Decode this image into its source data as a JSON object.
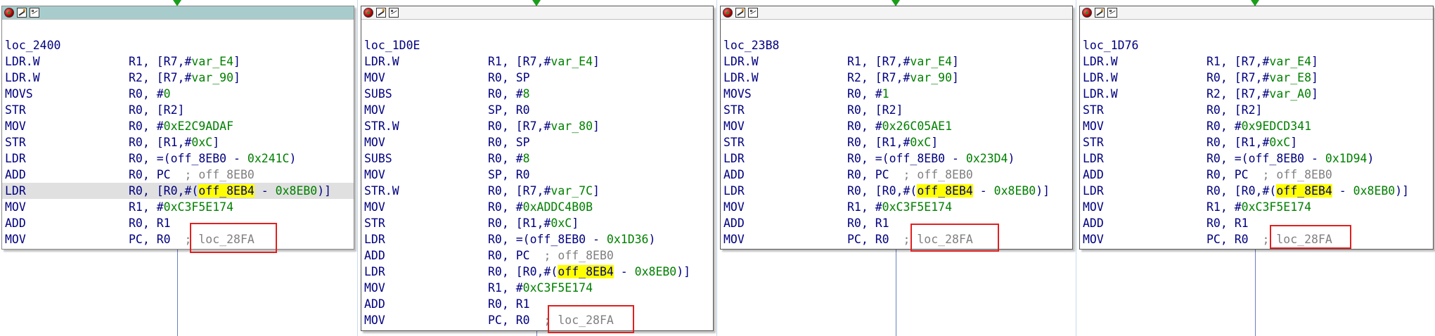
{
  "blocks": [
    {
      "label": "loc_2400",
      "selected": true,
      "lines": [
        {
          "mn": "LDR.W",
          "ops": [
            {
              "t": "op",
              "v": "R1, [R7,#"
            },
            {
              "t": "var",
              "v": "var_E4"
            },
            {
              "t": "op",
              "v": "]"
            }
          ]
        },
        {
          "mn": "LDR.W",
          "ops": [
            {
              "t": "op",
              "v": "R2, [R7,#"
            },
            {
              "t": "var",
              "v": "var_90"
            },
            {
              "t": "op",
              "v": "]"
            }
          ]
        },
        {
          "mn": "MOVS",
          "ops": [
            {
              "t": "op",
              "v": "R0, #"
            },
            {
              "t": "num",
              "v": "0"
            }
          ]
        },
        {
          "mn": "STR",
          "ops": [
            {
              "t": "op",
              "v": "R0, [R2]"
            }
          ]
        },
        {
          "mn": "MOV",
          "ops": [
            {
              "t": "op",
              "v": "R0, #"
            },
            {
              "t": "num",
              "v": "0xE2C9ADAF"
            }
          ]
        },
        {
          "mn": "STR",
          "ops": [
            {
              "t": "op",
              "v": "R0, [R1,#"
            },
            {
              "t": "num",
              "v": "0xC"
            },
            {
              "t": "op",
              "v": "]"
            }
          ]
        },
        {
          "mn": "LDR",
          "ops": [
            {
              "t": "op",
              "v": "R0, =(off_8EB0 - "
            },
            {
              "t": "num",
              "v": "0x241C"
            },
            {
              "t": "op",
              "v": ")"
            }
          ]
        },
        {
          "mn": "ADD",
          "ops": [
            {
              "t": "op",
              "v": "R0, PC  "
            },
            {
              "t": "cmt",
              "v": "; off_8EB0"
            }
          ]
        },
        {
          "mn": "LDR",
          "hl": true,
          "ops": [
            {
              "t": "op",
              "v": "R0, [R0,#("
            },
            {
              "t": "hlsym",
              "v": "off_8EB4"
            },
            {
              "t": "op",
              "v": " - "
            },
            {
              "t": "num",
              "v": "0x8EB0"
            },
            {
              "t": "op",
              "v": ")]"
            }
          ]
        },
        {
          "mn": "MOV",
          "ops": [
            {
              "t": "op",
              "v": "R1, #"
            },
            {
              "t": "num",
              "v": "0xC3F5E174"
            }
          ]
        },
        {
          "mn": "ADD",
          "ops": [
            {
              "t": "op",
              "v": "R0, R1"
            }
          ]
        },
        {
          "mn": "MOV",
          "ops": [
            {
              "t": "op",
              "v": "PC, R0  "
            },
            {
              "t": "cmt",
              "v": "; loc_28FA"
            }
          ]
        }
      ]
    },
    {
      "label": "loc_1D0E",
      "selected": false,
      "lines": [
        {
          "mn": "LDR.W",
          "ops": [
            {
              "t": "op",
              "v": "R1, [R7,#"
            },
            {
              "t": "var",
              "v": "var_E4"
            },
            {
              "t": "op",
              "v": "]"
            }
          ]
        },
        {
          "mn": "MOV",
          "ops": [
            {
              "t": "op",
              "v": "R0, SP"
            }
          ]
        },
        {
          "mn": "SUBS",
          "ops": [
            {
              "t": "op",
              "v": "R0, #"
            },
            {
              "t": "num",
              "v": "8"
            }
          ]
        },
        {
          "mn": "MOV",
          "ops": [
            {
              "t": "op",
              "v": "SP, R0"
            }
          ]
        },
        {
          "mn": "STR.W",
          "ops": [
            {
              "t": "op",
              "v": "R0, [R7,#"
            },
            {
              "t": "var",
              "v": "var_80"
            },
            {
              "t": "op",
              "v": "]"
            }
          ]
        },
        {
          "mn": "MOV",
          "ops": [
            {
              "t": "op",
              "v": "R0, SP"
            }
          ]
        },
        {
          "mn": "SUBS",
          "ops": [
            {
              "t": "op",
              "v": "R0, #"
            },
            {
              "t": "num",
              "v": "8"
            }
          ]
        },
        {
          "mn": "MOV",
          "ops": [
            {
              "t": "op",
              "v": "SP, R0"
            }
          ]
        },
        {
          "mn": "STR.W",
          "ops": [
            {
              "t": "op",
              "v": "R0, [R7,#"
            },
            {
              "t": "var",
              "v": "var_7C"
            },
            {
              "t": "op",
              "v": "]"
            }
          ]
        },
        {
          "mn": "MOV",
          "ops": [
            {
              "t": "op",
              "v": "R0, #"
            },
            {
              "t": "num",
              "v": "0xADDC4B0B"
            }
          ]
        },
        {
          "mn": "STR",
          "ops": [
            {
              "t": "op",
              "v": "R0, [R1,#"
            },
            {
              "t": "num",
              "v": "0xC"
            },
            {
              "t": "op",
              "v": "]"
            }
          ]
        },
        {
          "mn": "LDR",
          "ops": [
            {
              "t": "op",
              "v": "R0, =(off_8EB0 - "
            },
            {
              "t": "num",
              "v": "0x1D36"
            },
            {
              "t": "op",
              "v": ")"
            }
          ]
        },
        {
          "mn": "ADD",
          "ops": [
            {
              "t": "op",
              "v": "R0, PC  "
            },
            {
              "t": "cmt",
              "v": "; off_8EB0"
            }
          ]
        },
        {
          "mn": "LDR",
          "ops": [
            {
              "t": "op",
              "v": "R0, [R0,#("
            },
            {
              "t": "hlsym",
              "v": "off_8EB4"
            },
            {
              "t": "op",
              "v": " - "
            },
            {
              "t": "num",
              "v": "0x8EB0"
            },
            {
              "t": "op",
              "v": ")]"
            }
          ]
        },
        {
          "mn": "MOV",
          "ops": [
            {
              "t": "op",
              "v": "R1, #"
            },
            {
              "t": "num",
              "v": "0xC3F5E174"
            }
          ]
        },
        {
          "mn": "ADD",
          "ops": [
            {
              "t": "op",
              "v": "R0, R1"
            }
          ]
        },
        {
          "mn": "MOV",
          "ops": [
            {
              "t": "op",
              "v": "PC, R0  "
            },
            {
              "t": "cmt",
              "v": "; loc_28FA"
            }
          ]
        }
      ]
    },
    {
      "label": "loc_23B8",
      "selected": false,
      "lines": [
        {
          "mn": "LDR.W",
          "ops": [
            {
              "t": "op",
              "v": "R1, [R7,#"
            },
            {
              "t": "var",
              "v": "var_E4"
            },
            {
              "t": "op",
              "v": "]"
            }
          ]
        },
        {
          "mn": "LDR.W",
          "ops": [
            {
              "t": "op",
              "v": "R2, [R7,#"
            },
            {
              "t": "var",
              "v": "var_90"
            },
            {
              "t": "op",
              "v": "]"
            }
          ]
        },
        {
          "mn": "MOVS",
          "ops": [
            {
              "t": "op",
              "v": "R0, #"
            },
            {
              "t": "num",
              "v": "1"
            }
          ]
        },
        {
          "mn": "STR",
          "ops": [
            {
              "t": "op",
              "v": "R0, [R2]"
            }
          ]
        },
        {
          "mn": "MOV",
          "ops": [
            {
              "t": "op",
              "v": "R0, #"
            },
            {
              "t": "num",
              "v": "0x26C05AE1"
            }
          ]
        },
        {
          "mn": "STR",
          "ops": [
            {
              "t": "op",
              "v": "R0, [R1,#"
            },
            {
              "t": "num",
              "v": "0xC"
            },
            {
              "t": "op",
              "v": "]"
            }
          ]
        },
        {
          "mn": "LDR",
          "ops": [
            {
              "t": "op",
              "v": "R0, =(off_8EB0 - "
            },
            {
              "t": "num",
              "v": "0x23D4"
            },
            {
              "t": "op",
              "v": ")"
            }
          ]
        },
        {
          "mn": "ADD",
          "ops": [
            {
              "t": "op",
              "v": "R0, PC  "
            },
            {
              "t": "cmt",
              "v": "; off_8EB0"
            }
          ]
        },
        {
          "mn": "LDR",
          "ops": [
            {
              "t": "op",
              "v": "R0, [R0,#("
            },
            {
              "t": "hlsym",
              "v": "off_8EB4"
            },
            {
              "t": "op",
              "v": " - "
            },
            {
              "t": "num",
              "v": "0x8EB0"
            },
            {
              "t": "op",
              "v": ")]"
            }
          ]
        },
        {
          "mn": "MOV",
          "ops": [
            {
              "t": "op",
              "v": "R1, #"
            },
            {
              "t": "num",
              "v": "0xC3F5E174"
            }
          ]
        },
        {
          "mn": "ADD",
          "ops": [
            {
              "t": "op",
              "v": "R0, R1"
            }
          ]
        },
        {
          "mn": "MOV",
          "ops": [
            {
              "t": "op",
              "v": "PC, R0  "
            },
            {
              "t": "cmt",
              "v": "; loc_28FA"
            }
          ]
        }
      ]
    },
    {
      "label": "loc_1D76",
      "selected": false,
      "lines": [
        {
          "mn": "LDR.W",
          "ops": [
            {
              "t": "op",
              "v": "R1, [R7,#"
            },
            {
              "t": "var",
              "v": "var_E4"
            },
            {
              "t": "op",
              "v": "]"
            }
          ]
        },
        {
          "mn": "LDR.W",
          "ops": [
            {
              "t": "op",
              "v": "R0, [R7,#"
            },
            {
              "t": "var",
              "v": "var_E8"
            },
            {
              "t": "op",
              "v": "]"
            }
          ]
        },
        {
          "mn": "LDR.W",
          "ops": [
            {
              "t": "op",
              "v": "R2, [R7,#"
            },
            {
              "t": "var",
              "v": "var_A0"
            },
            {
              "t": "op",
              "v": "]"
            }
          ]
        },
        {
          "mn": "STR",
          "ops": [
            {
              "t": "op",
              "v": "R0, [R2]"
            }
          ]
        },
        {
          "mn": "MOV",
          "ops": [
            {
              "t": "op",
              "v": "R0, #"
            },
            {
              "t": "num",
              "v": "0x9EDCD341"
            }
          ]
        },
        {
          "mn": "STR",
          "ops": [
            {
              "t": "op",
              "v": "R0, [R1,#"
            },
            {
              "t": "num",
              "v": "0xC"
            },
            {
              "t": "op",
              "v": "]"
            }
          ]
        },
        {
          "mn": "LDR",
          "ops": [
            {
              "t": "op",
              "v": "R0, =(off_8EB0 - "
            },
            {
              "t": "num",
              "v": "0x1D94"
            },
            {
              "t": "op",
              "v": ")"
            }
          ]
        },
        {
          "mn": "ADD",
          "ops": [
            {
              "t": "op",
              "v": "R0, PC  "
            },
            {
              "t": "cmt",
              "v": "; off_8EB0"
            }
          ]
        },
        {
          "mn": "LDR",
          "ops": [
            {
              "t": "op",
              "v": "R0, [R0,#("
            },
            {
              "t": "hlsym",
              "v": "off_8EB4"
            },
            {
              "t": "op",
              "v": " - "
            },
            {
              "t": "num",
              "v": "0x8EB0"
            },
            {
              "t": "op",
              "v": ")]"
            }
          ]
        },
        {
          "mn": "MOV",
          "ops": [
            {
              "t": "op",
              "v": "R1, #"
            },
            {
              "t": "num",
              "v": "0xC3F5E174"
            }
          ]
        },
        {
          "mn": "ADD",
          "ops": [
            {
              "t": "op",
              "v": "R0, R1"
            }
          ]
        },
        {
          "mn": "MOV",
          "ops": [
            {
              "t": "op",
              "v": "PC, R0  "
            },
            {
              "t": "cmt",
              "v": "; loc_28FA"
            }
          ]
        }
      ]
    }
  ],
  "colors": {
    "mnemonic": "#000080",
    "variable": "#008000",
    "number": "#008000",
    "comment": "#808080",
    "symbol_highlight": "#ffff00",
    "annotation_box": "#e02020",
    "edge": "#6680c0",
    "entry_arrow": "#1a9e1a"
  },
  "icons": [
    "color-picker-icon",
    "rename-icon",
    "graph-view-icon"
  ]
}
